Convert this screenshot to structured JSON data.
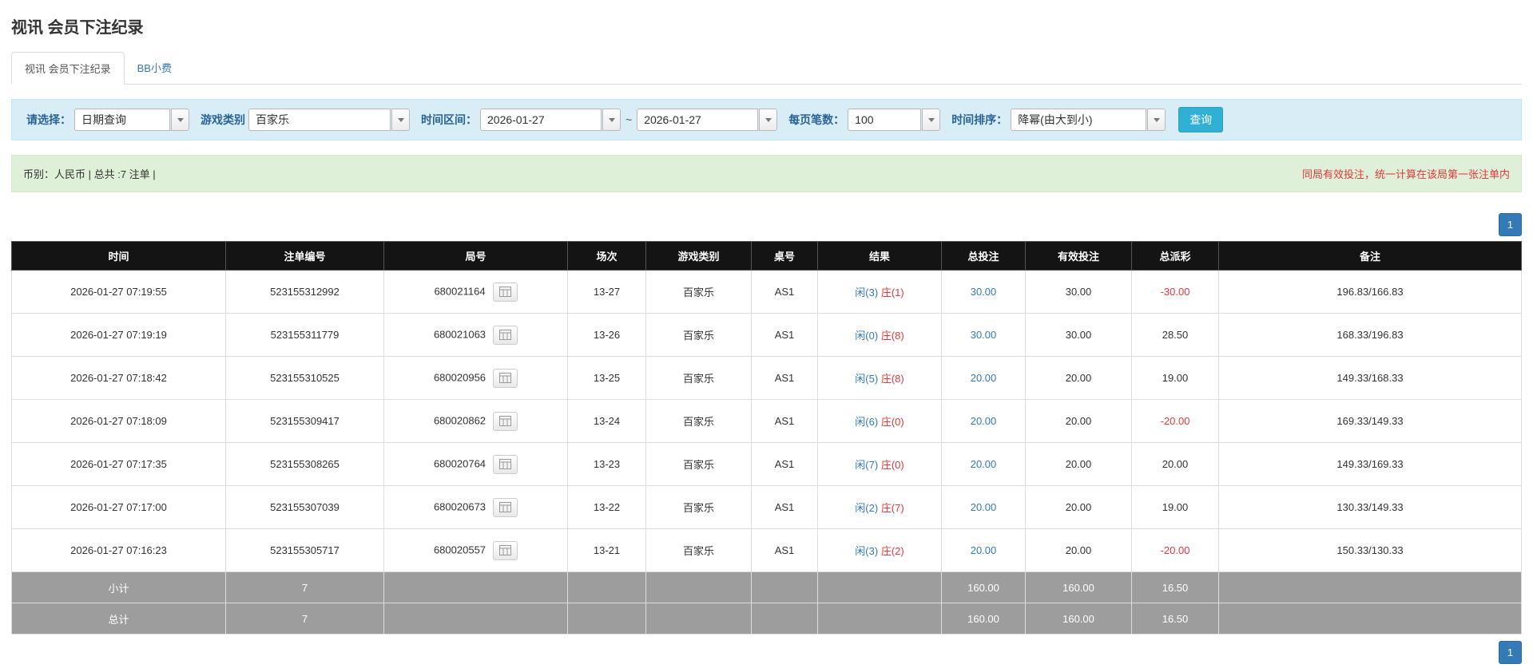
{
  "page": {
    "title": "视讯 会员下注纪录"
  },
  "tabs": [
    {
      "label": "视讯 会员下注纪录",
      "active": true
    },
    {
      "label": "BB小费",
      "active": false
    }
  ],
  "filters": {
    "select_label": "请选择：",
    "select_value": "日期查询",
    "game_label": "游戏类别",
    "game_value": "百家乐",
    "range_label": "时间区间：",
    "date_from": "2026-01-27",
    "range_separator": "~",
    "date_to": "2026-01-27",
    "page_size_label": "每页笔数：",
    "page_size_value": "100",
    "sort_label": "时间排序：",
    "sort_value": "降幂(由大到小)",
    "search_button": "查询"
  },
  "summary": {
    "left": "币别：人民币 | 总共 :7 注单 |",
    "right": "同局有效投注，统一计算在该局第一张注单内"
  },
  "pagination": {
    "page": "1"
  },
  "table": {
    "headers": [
      "时间",
      "注单编号",
      "局号",
      "场次",
      "游戏类别",
      "桌号",
      "结果",
      "总投注",
      "有效投注",
      "总派彩",
      "备注"
    ],
    "rows": [
      {
        "time": "2026-01-27 07:19:55",
        "bet_no": "523155312992",
        "round_no": "680021164",
        "session": "13-27",
        "game": "百家乐",
        "table_no": "AS1",
        "result_player": "闲(3)",
        "result_banker": "庄(1)",
        "total_bet": "30.00",
        "valid_bet": "30.00",
        "payout": "-30.00",
        "note": "196.83/166.83"
      },
      {
        "time": "2026-01-27 07:19:19",
        "bet_no": "523155311779",
        "round_no": "680021063",
        "session": "13-26",
        "game": "百家乐",
        "table_no": "AS1",
        "result_player": "闲(0)",
        "result_banker": "庄(8)",
        "total_bet": "30.00",
        "valid_bet": "30.00",
        "payout": "28.50",
        "note": "168.33/196.83"
      },
      {
        "time": "2026-01-27 07:18:42",
        "bet_no": "523155310525",
        "round_no": "680020956",
        "session": "13-25",
        "game": "百家乐",
        "table_no": "AS1",
        "result_player": "闲(5)",
        "result_banker": "庄(8)",
        "total_bet": "20.00",
        "valid_bet": "20.00",
        "payout": "19.00",
        "note": "149.33/168.33"
      },
      {
        "time": "2026-01-27 07:18:09",
        "bet_no": "523155309417",
        "round_no": "680020862",
        "session": "13-24",
        "game": "百家乐",
        "table_no": "AS1",
        "result_player": "闲(6)",
        "result_banker": "庄(0)",
        "total_bet": "20.00",
        "valid_bet": "20.00",
        "payout": "-20.00",
        "note": "169.33/149.33"
      },
      {
        "time": "2026-01-27 07:17:35",
        "bet_no": "523155308265",
        "round_no": "680020764",
        "session": "13-23",
        "game": "百家乐",
        "table_no": "AS1",
        "result_player": "闲(7)",
        "result_banker": "庄(0)",
        "total_bet": "20.00",
        "valid_bet": "20.00",
        "payout": "20.00",
        "note": "149.33/169.33"
      },
      {
        "time": "2026-01-27 07:17:00",
        "bet_no": "523155307039",
        "round_no": "680020673",
        "session": "13-22",
        "game": "百家乐",
        "table_no": "AS1",
        "result_player": "闲(2)",
        "result_banker": "庄(7)",
        "total_bet": "20.00",
        "valid_bet": "20.00",
        "payout": "19.00",
        "note": "130.33/149.33"
      },
      {
        "time": "2026-01-27 07:16:23",
        "bet_no": "523155305717",
        "round_no": "680020557",
        "session": "13-21",
        "game": "百家乐",
        "table_no": "AS1",
        "result_player": "闲(3)",
        "result_banker": "庄(2)",
        "total_bet": "20.00",
        "valid_bet": "20.00",
        "payout": "-20.00",
        "note": "150.33/130.33"
      }
    ],
    "footer": [
      {
        "label": "小计",
        "count": "7",
        "total_bet": "160.00",
        "valid_bet": "160.00",
        "payout": "16.50"
      },
      {
        "label": "总计",
        "count": "7",
        "total_bet": "160.00",
        "valid_bet": "160.00",
        "payout": "16.50"
      }
    ]
  },
  "colors": {
    "filter_bar_bg": "#d9edf7",
    "summary_bar_bg": "#dff0d8",
    "table_header_bg": "#141414",
    "footer_row_bg": "#9d9d9d",
    "link_blue": "#337ab7",
    "player_blue": "#337ab7",
    "banker_red": "#e4393c",
    "negative_red": "#e4393c",
    "warning_red": "#e4393c",
    "search_button_bg": "#31b0d5",
    "pagination_bg": "#337ab7"
  }
}
